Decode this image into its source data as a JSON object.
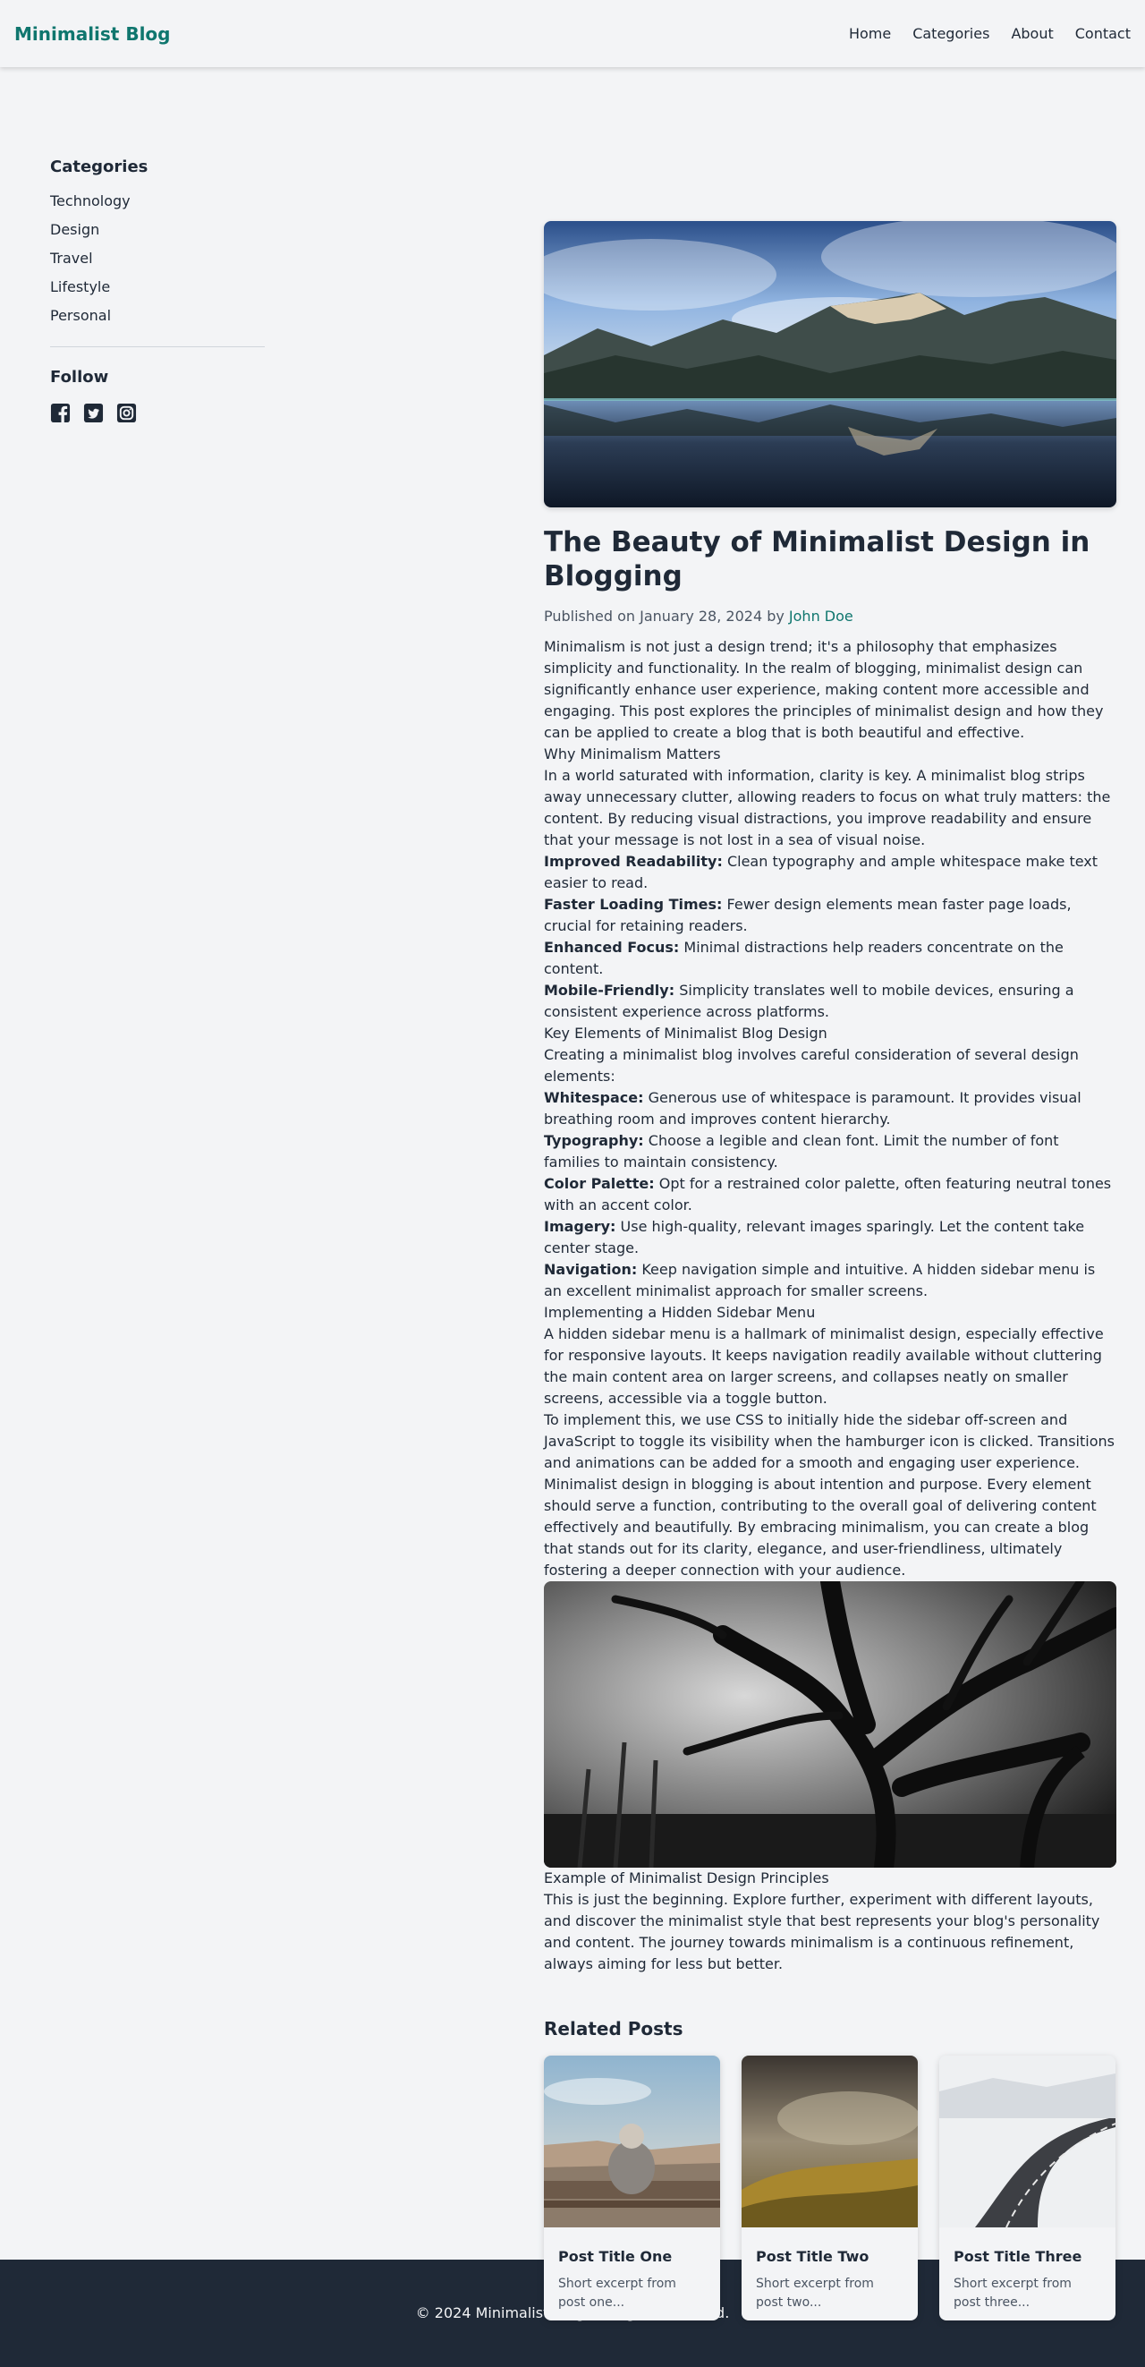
{
  "header": {
    "brand": "Minimalist Blog",
    "nav": [
      "Home",
      "Categories",
      "About",
      "Contact"
    ]
  },
  "sidebar": {
    "categories_title": "Categories",
    "categories": [
      "Technology",
      "Design",
      "Travel",
      "Lifestyle",
      "Personal"
    ],
    "follow_title": "Follow",
    "social_icons": [
      "facebook-icon",
      "twitter-icon",
      "instagram-icon"
    ]
  },
  "article": {
    "title": "The Beauty of Minimalist Design in Blogging",
    "published_prefix": "Published on January 28, 2024 by ",
    "author": "John Doe",
    "intro": "Minimalism is not just a design trend; it's a philosophy that emphasizes simplicity and functionality. In the realm of blogging, minimalist design can significantly enhance user experience, making content more accessible and engaging. This post explores the principles of minimalist design and how they can be applied to create a blog that is both beautiful and effective.",
    "h_why": "Why Minimalism Matters",
    "why_text": "In a world saturated with information, clarity is key. A minimalist blog strips away unnecessary clutter, allowing readers to focus on what truly matters: the content. By reducing visual distractions, you improve readability and ensure that your message is not lost in a sea of visual noise.",
    "benefits": [
      {
        "term": "Improved Readability:",
        "text": " Clean typography and ample whitespace make text easier to read."
      },
      {
        "term": "Faster Loading Times:",
        "text": " Fewer design elements mean faster page loads, crucial for retaining readers."
      },
      {
        "term": "Enhanced Focus:",
        "text": " Minimal distractions help readers concentrate on the content."
      },
      {
        "term": "Mobile-Friendly:",
        "text": " Simplicity translates well to mobile devices, ensuring a consistent experience across platforms."
      }
    ],
    "h_key": "Key Elements of Minimalist Blog Design",
    "key_text": "Creating a minimalist blog involves careful consideration of several design elements:",
    "elements": [
      {
        "term": "Whitespace:",
        "text": " Generous use of whitespace is paramount. It provides visual breathing room and improves content hierarchy."
      },
      {
        "term": "Typography:",
        "text": " Choose a legible and clean font. Limit the number of font families to maintain consistency."
      },
      {
        "term": "Color Palette:",
        "text": " Opt for a restrained color palette, often featuring neutral tones with an accent color."
      },
      {
        "term": "Imagery:",
        "text": " Use high-quality, relevant images sparingly. Let the content take center stage."
      },
      {
        "term": "Navigation:",
        "text": " Keep navigation simple and intuitive. A hidden sidebar menu is an excellent minimalist approach for smaller screens."
      }
    ],
    "h_impl": "Implementing a Hidden Sidebar Menu",
    "impl_text1": "A hidden sidebar menu is a hallmark of minimalist design, especially effective for responsive layouts. It keeps navigation readily available without cluttering the main content area on larger screens, and collapses neatly on smaller screens, accessible via a toggle button.",
    "impl_text2": "To implement this, we use CSS to initially hide the sidebar off-screen and JavaScript to toggle its visibility when the hamburger icon is clicked. Transitions and animations can be added for a smooth and engaging user experience.",
    "conclusion": "Minimalist design in blogging is about intention and purpose. Every element should serve a function, contributing to the overall goal of delivering content effectively and beautifully. By embracing minimalism, you can create a blog that stands out for its clarity, elegance, and user-friendliness, ultimately fostering a deeper connection with your audience.",
    "caption": "Example of Minimalist Design Principles",
    "outro": "This is just the beginning. Explore further, experiment with different layouts, and discover the minimalist style that best represents your blog's personality and content. The journey towards minimalism is a continuous refinement, always aiming for less but better."
  },
  "related": {
    "title": "Related Posts",
    "posts": [
      {
        "title": "Post Title One",
        "excerpt": "Short excerpt from post one..."
      },
      {
        "title": "Post Title Two",
        "excerpt": "Short excerpt from post two..."
      },
      {
        "title": "Post Title Three",
        "excerpt": "Short excerpt from post three..."
      }
    ]
  },
  "footer": {
    "copyright": "© 2024 Minimalist Blog. All rights reserved."
  },
  "colors": {
    "accent": "#0f766e",
    "background": "#f3f4f6",
    "text": "#1f2937",
    "footer_bg": "#1f2937"
  }
}
